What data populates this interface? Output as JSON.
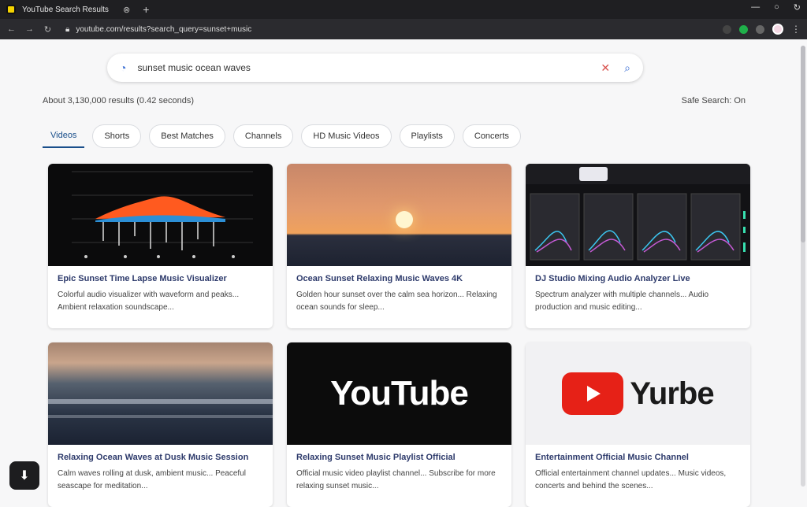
{
  "browser": {
    "tab_title": "YouTube Search Results",
    "tab_close": "⊗",
    "new_tab": "+",
    "window_controls": [
      "—",
      "○",
      "↻"
    ],
    "address": "youtube.com/results?search_query=sunset+music",
    "nav_icons": [
      "←",
      "→",
      "↻"
    ]
  },
  "search": {
    "value": "sunset music ocean waves",
    "placeholder": "Search"
  },
  "results": {
    "meta_left": "About 3,130,000 results (0.42 seconds)",
    "meta_right": "Safe Search: On"
  },
  "filters": [
    "Videos",
    "Shorts",
    "Best Matches",
    "Channels",
    "HD Music Videos",
    "Playlists",
    "Concerts"
  ],
  "cards": [
    {
      "title": "Epic Sunset Time Lapse Music Visualizer",
      "snippet": "Colorful audio visualizer with waveform and peaks... Ambient relaxation soundscape..."
    },
    {
      "title": "Ocean Sunset Relaxing Music Waves 4K",
      "snippet": "Golden hour sunset over the calm sea horizon... Relaxing ocean sounds for sleep..."
    },
    {
      "title": "DJ Studio Mixing Audio Analyzer Live",
      "snippet": "Spectrum analyzer with multiple channels... Audio production and music editing..."
    },
    {
      "title": "Relaxing Ocean Waves at Dusk Music Session",
      "snippet": "Calm waves rolling at dusk, ambient music... Peaceful seascape for meditation..."
    },
    {
      "title": "Relaxing Sunset Music Playlist Official",
      "snippet": "Official music video playlist channel... Subscribe for more relaxing sunset music..."
    },
    {
      "title": "Entertainment Official Music Channel",
      "snippet": "Official entertainment channel updates... Music videos, concerts and behind the scenes..."
    }
  ],
  "logos": {
    "youtube1": "YouTube",
    "youtube2": "Yurbe"
  },
  "colors": {
    "accent": "#1a4f8b",
    "youtube_red": "#e62117"
  }
}
